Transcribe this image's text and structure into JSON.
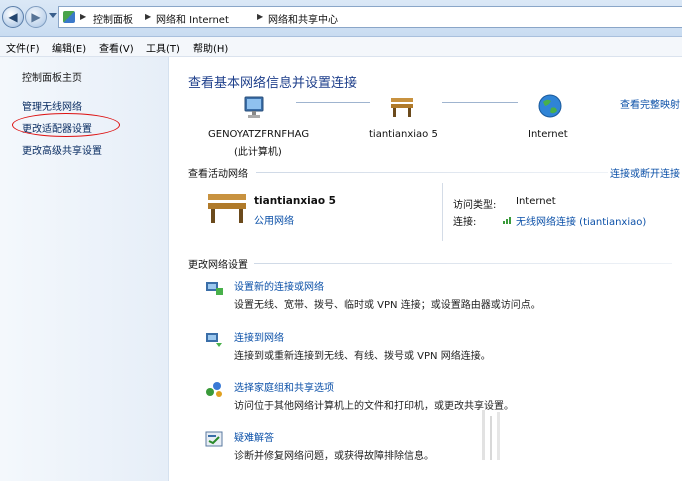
{
  "breadcrumb": {
    "items": [
      "控制面板",
      "网络和 Internet",
      "网络和共享中心"
    ]
  },
  "menubar": {
    "items": [
      "文件(F)",
      "编辑(E)",
      "查看(V)",
      "工具(T)",
      "帮助(H)"
    ]
  },
  "sidebar": {
    "home": "控制面板主页",
    "links": [
      "管理无线网络",
      "更改适配器设置",
      "更改高级共享设置"
    ]
  },
  "main": {
    "title": "查看基本网络信息并设置连接",
    "full_map_link": "查看完整映射",
    "map": {
      "computer_name": "GENOYATZFRNFHAG",
      "computer_sub": "(此计算机)",
      "network_name": "tiantianxiao  5",
      "internet": "Internet"
    },
    "active_section": {
      "heading": "查看活动网络",
      "link": "连接或断开连接",
      "network_name": "tiantianxiao  5",
      "network_type": "公用网络",
      "access_type_label": "访问类型:",
      "access_type_value": "Internet",
      "connection_label": "连接:",
      "connection_value": "无线网络连接 (tiantianxiao)"
    },
    "settings_section": {
      "heading": "更改网络设置",
      "tasks": [
        {
          "title": "设置新的连接或网络",
          "desc": "设置无线、宽带、拨号、临时或 VPN 连接；或设置路由器或访问点。"
        },
        {
          "title": "连接到网络",
          "desc": "连接到或重新连接到无线、有线、拨号或 VPN 网络连接。"
        },
        {
          "title": "选择家庭组和共享选项",
          "desc": "访问位于其他网络计算机上的文件和打印机，或更改共享设置。"
        },
        {
          "title": "疑难解答",
          "desc": "诊断并修复网络问题，或获得故障排除信息。"
        }
      ]
    }
  },
  "colors": {
    "link": "#0b50a8",
    "title": "#1e3f8b",
    "annotation_circle": "#dd1111"
  }
}
